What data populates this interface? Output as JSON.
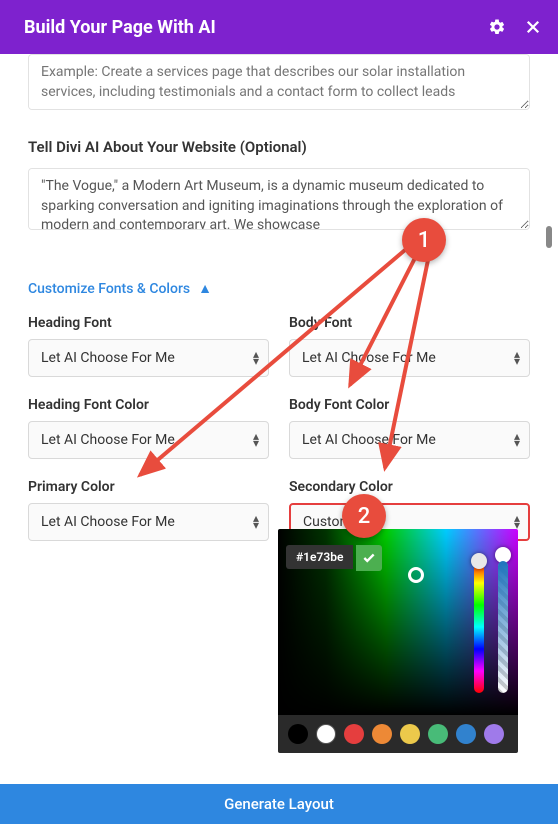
{
  "header": {
    "title": "Build Your Page With AI"
  },
  "prompt": {
    "placeholder": "Example: Create a services page that describes our solar installation services, including testimonials and a contact form to collect leads"
  },
  "aboutSection": {
    "label": "Tell Divi AI About Your Website (Optional)",
    "value": "\"The Vogue,\" a Modern Art Museum, is a dynamic museum dedicated to sparking conversation and igniting imaginations through the exploration of modern and contemporary art. We showcase"
  },
  "customize": {
    "linkLabel": "Customize Fonts & Colors"
  },
  "fields": {
    "headingFont": {
      "label": "Heading Font",
      "value": "Let AI Choose For Me"
    },
    "bodyFont": {
      "label": "Body Font",
      "value": "Let AI Choose For Me"
    },
    "headingFontColor": {
      "label": "Heading Font Color",
      "value": "Let AI Choose For Me"
    },
    "bodyFontColor": {
      "label": "Body Font Color",
      "value": "Let AI Choose For Me"
    },
    "primaryColor": {
      "label": "Primary Color",
      "value": "Let AI Choose For Me"
    },
    "secondaryColor": {
      "label": "Secondary Color",
      "value": "Custom"
    }
  },
  "colorPicker": {
    "hex": "#1e73be",
    "swatches": [
      "#000000",
      "#ffffff",
      "#e53e3e",
      "#ed8936",
      "#ecc94b",
      "#48bb78",
      "#3182ce",
      "#9f7aea"
    ]
  },
  "footer": {
    "generateLabel": "Generate Layout"
  },
  "annotations": {
    "one": "1",
    "two": "2"
  }
}
